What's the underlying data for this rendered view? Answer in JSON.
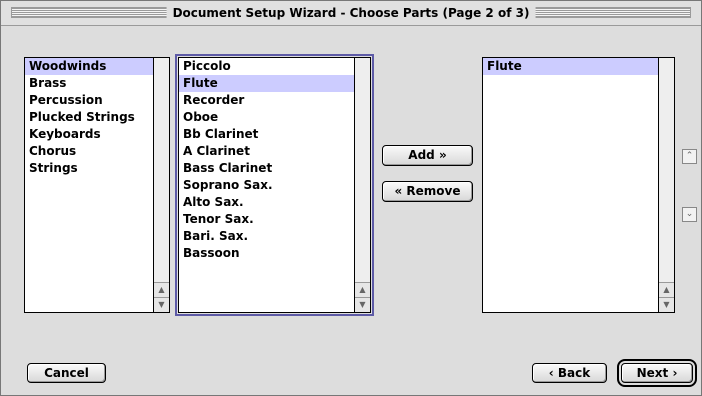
{
  "window": {
    "title": "Document Setup Wizard - Choose Parts (Page 2 of 3)"
  },
  "categories": {
    "items": [
      "Woodwinds",
      "Brass",
      "Percussion",
      "Plucked Strings",
      "Keyboards",
      "Chorus",
      "Strings"
    ],
    "selected": "Woodwinds"
  },
  "instruments": {
    "items": [
      "Piccolo",
      "Flute",
      "Recorder",
      "Oboe",
      "Bb Clarinet",
      "A Clarinet",
      "Bass Clarinet",
      "Soprano Sax.",
      "Alto Sax.",
      "Tenor Sax.",
      "Bari. Sax.",
      "Bassoon"
    ],
    "selected": "Flute"
  },
  "chosen": {
    "items": [
      "Flute"
    ],
    "selected": "Flute"
  },
  "buttons": {
    "add": "Add »",
    "remove": "« Remove",
    "cancel": "Cancel",
    "back": "‹ Back",
    "next": "Next ›"
  },
  "icons": {
    "scroll_up": "▲",
    "scroll_down": "▼",
    "move_up": "⌃",
    "move_down": "⌄"
  }
}
